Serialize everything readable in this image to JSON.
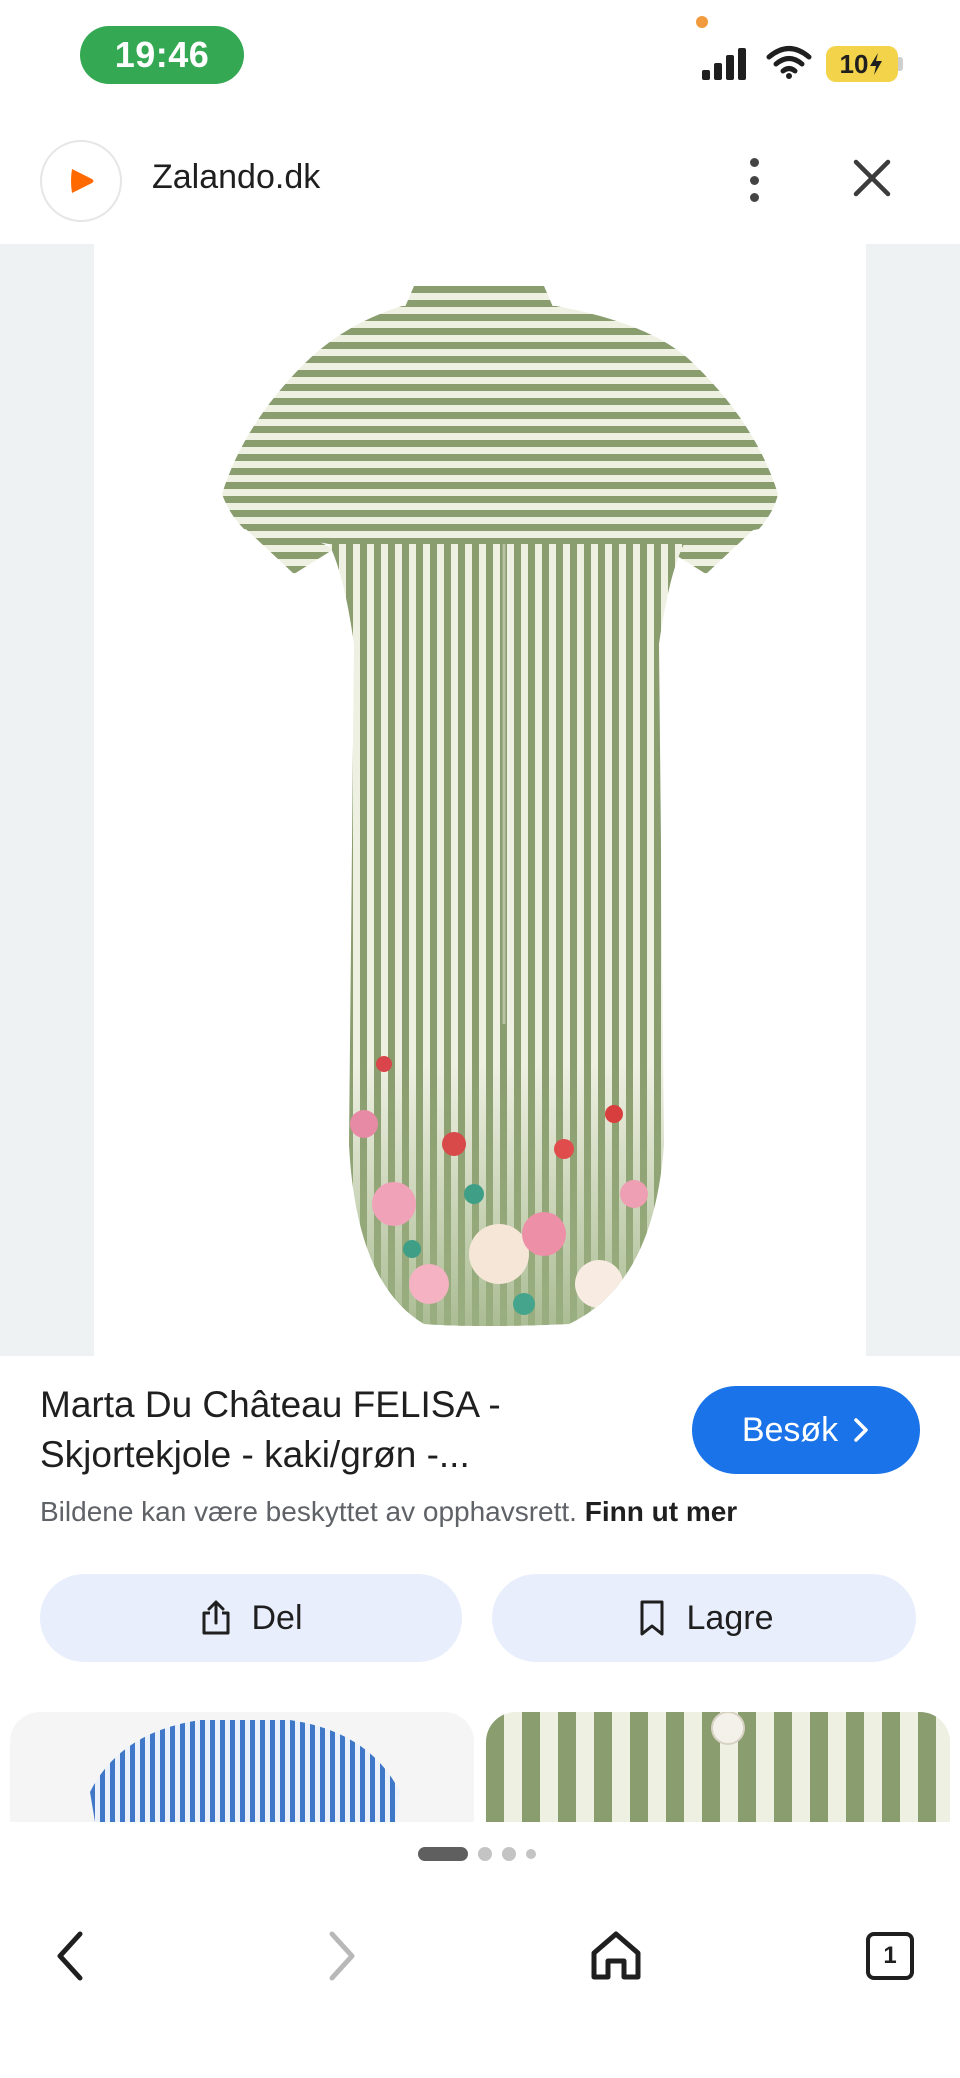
{
  "status_bar": {
    "time": "19:46",
    "battery": "10",
    "icons": [
      "signal-icon",
      "wifi-icon",
      "battery-charging-icon"
    ]
  },
  "header": {
    "site_name": "Zalando.dk",
    "logo_icon": "zalando-logo-icon",
    "menu_icon": "more-vert-icon",
    "close_icon": "close-icon"
  },
  "product": {
    "title": "Marta Du Château FELISA - Skjortekjole - kaki/grøn -...",
    "visit_label": "Besøk",
    "copyright_text": "Bildene kan være beskyttet av opphavsrett.",
    "learn_more": "Finn ut mer"
  },
  "actions": {
    "share_label": "Del",
    "save_label": "Lagre"
  },
  "related": {
    "items": [
      {
        "name": "blue-striped-shirt-thumbnail"
      },
      {
        "name": "green-striped-dress-closeup-thumbnail"
      }
    ]
  },
  "carousel": {
    "active_index": 0,
    "total": 4
  },
  "nav": {
    "tab_count": "1",
    "icons": [
      "back-icon",
      "forward-icon",
      "home-icon",
      "tabs-icon"
    ]
  },
  "colors": {
    "accent": "#1a73e8",
    "time_pill": "#34a853",
    "action_bg": "#e8eefc",
    "dress_stripe": "#8a9d6f",
    "dress_base": "#eef0e2"
  }
}
